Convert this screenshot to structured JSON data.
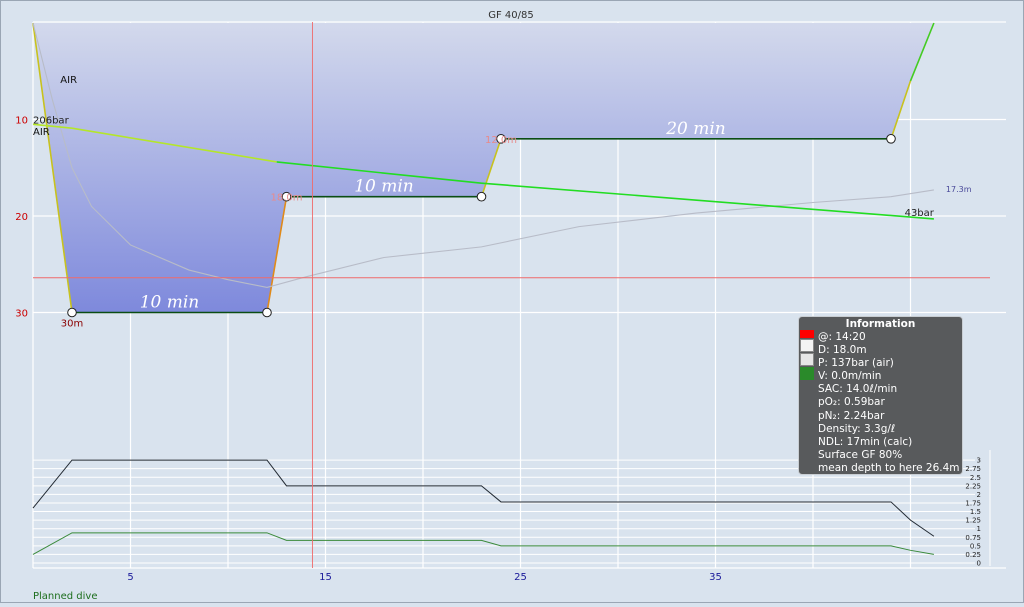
{
  "title": "GF 40/85",
  "footer_label": "Planned dive",
  "colors": {
    "background": "#d9e3ee",
    "profile_top": "#d3d9ec",
    "profile_bottom": "#7e89dc",
    "profile_edge": "#c8c21e",
    "ascent_edge": "#e08a1a",
    "bottom_segment": "#0b4d14",
    "pressure_line": "#22dd22",
    "ceiling_line": "#b8bcc8",
    "crosshair": "#f06a6a",
    "depth_tick": "#cc0000",
    "time_tick": "#1a1a9a",
    "info_bg": "#585a5c",
    "tissue_top": "#222a33",
    "tissue_bottom": "#3a8a3a"
  },
  "chart_data": {
    "type": "line",
    "title": "GF 40/85",
    "x_axis": {
      "unit": "min",
      "ticks": [
        5,
        15,
        25,
        35
      ],
      "range": [
        0,
        46.3
      ]
    },
    "y_axis": {
      "unit": "m",
      "ticks": [
        10,
        20,
        30
      ],
      "range": [
        -1,
        45
      ],
      "inverted": true
    },
    "profile": [
      {
        "t": 0,
        "d": 0
      },
      {
        "t": 2,
        "d": 30
      },
      {
        "t": 12,
        "d": 30
      },
      {
        "t": 13,
        "d": 18
      },
      {
        "t": 23,
        "d": 18
      },
      {
        "t": 24,
        "d": 12
      },
      {
        "t": 44,
        "d": 12
      },
      {
        "t": 45,
        "d": 6
      },
      {
        "t": 46.2,
        "d": 0
      }
    ],
    "waypoints": [
      {
        "t": 2,
        "d": 30,
        "label": "30m"
      },
      {
        "t": 12,
        "d": 30,
        "label": ""
      },
      {
        "t": 13,
        "d": 18,
        "label": "18.0m"
      },
      {
        "t": 23,
        "d": 18,
        "label": ""
      },
      {
        "t": 24,
        "d": 12,
        "label": "12.0m"
      },
      {
        "t": 44,
        "d": 12,
        "label": ""
      }
    ],
    "segment_labels": [
      {
        "t": 7,
        "d": 30,
        "text": "10 min"
      },
      {
        "t": 18,
        "d": 18,
        "text": "10 min"
      },
      {
        "t": 34,
        "d": 12,
        "text": "20 min"
      }
    ],
    "gas_labels": [
      {
        "t": 0,
        "d": 11.2,
        "text": "AIR"
      },
      {
        "t": 1.4,
        "d": 5.8,
        "text": "AIR"
      }
    ],
    "pressure": {
      "start_label": "206bar",
      "end_label": "43bar",
      "points": [
        {
          "t": 0,
          "d": 10.5
        },
        {
          "t": 2,
          "d": 10.9
        },
        {
          "t": 12.5,
          "d": 14.4
        },
        {
          "t": 23,
          "d": 16.6
        },
        {
          "t": 46.2,
          "d": 20.3
        }
      ]
    },
    "ceiling": {
      "end_label": "17.3m",
      "points": [
        {
          "t": 0,
          "d": 0
        },
        {
          "t": 1,
          "d": 8
        },
        {
          "t": 2,
          "d": 15
        },
        {
          "t": 3,
          "d": 19
        },
        {
          "t": 5,
          "d": 23
        },
        {
          "t": 8,
          "d": 25.6
        },
        {
          "t": 10,
          "d": 26.6
        },
        {
          "t": 12,
          "d": 27.4
        },
        {
          "t": 14,
          "d": 26.3
        },
        {
          "t": 18,
          "d": 24.3
        },
        {
          "t": 23,
          "d": 23.2
        },
        {
          "t": 28,
          "d": 21.1
        },
        {
          "t": 34,
          "d": 19.7
        },
        {
          "t": 40,
          "d": 18.6
        },
        {
          "t": 44,
          "d": 18
        },
        {
          "t": 46.2,
          "d": 17.3
        }
      ]
    },
    "crosshair": {
      "t": 14.33,
      "d": 26.4
    },
    "gas_pressure_axis": {
      "ticks": [
        0,
        0.25,
        0.5,
        0.75,
        1,
        1.25,
        1.5,
        1.75,
        2,
        2.25,
        2.5,
        2.75,
        3
      ],
      "range": [
        0,
        3
      ]
    },
    "tissue_series": [
      {
        "values": [
          {
            "t": 0,
            "v": 1.6
          },
          {
            "t": 2,
            "v": 3.0
          },
          {
            "t": 12,
            "v": 3.0
          },
          {
            "t": 13,
            "v": 2.25
          },
          {
            "t": 23,
            "v": 2.25
          },
          {
            "t": 24,
            "v": 1.78
          },
          {
            "t": 44,
            "v": 1.78
          },
          {
            "t": 45,
            "v": 1.25
          },
          {
            "t": 46.2,
            "v": 0.78
          }
        ]
      },
      {
        "values": [
          {
            "t": 0,
            "v": 0.25
          },
          {
            "t": 2,
            "v": 0.88
          },
          {
            "t": 12,
            "v": 0.88
          },
          {
            "t": 13,
            "v": 0.66
          },
          {
            "t": 23,
            "v": 0.66
          },
          {
            "t": 24,
            "v": 0.5
          },
          {
            "t": 44,
            "v": 0.5
          },
          {
            "t": 45,
            "v": 0.37
          },
          {
            "t": 46.2,
            "v": 0.25
          }
        ]
      }
    ]
  },
  "info": {
    "title": "Information",
    "lines": [
      "@: 14:20",
      "D: 18.0m",
      "P: 137bar (air)",
      "V: 0.0m/min",
      "SAC: 14.0ℓ/min",
      "pO₂: 0.59bar",
      "pN₂: 2.24bar",
      "Density: 3.3g/ℓ",
      "NDL: 17min (calc)",
      "Surface GF 80%",
      "mean depth to here 26.4m"
    ]
  }
}
